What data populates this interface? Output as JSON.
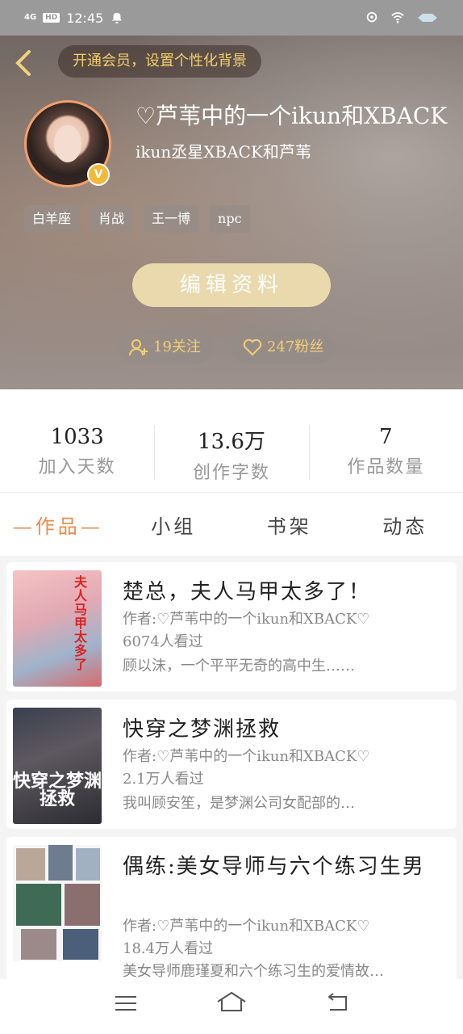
{
  "status_bar": {
    "network": "4G",
    "hd": "HD",
    "time": "12:45",
    "icons": [
      "location-icon",
      "wifi-icon",
      "battery-icon"
    ]
  },
  "header": {
    "back_glyph": "‹",
    "vip_banner": "开通会员，设置个性化背景",
    "nickname": "♡芦苇中的一个ikun和XBACK",
    "signature": "ikun丞星XBACK和芦苇",
    "badge": "V",
    "tags": [
      "白羊座",
      "肖战",
      "王一博",
      "npc"
    ],
    "edit_button": "编辑资料",
    "follow": "19关注",
    "fans": "247粉丝"
  },
  "stats": [
    {
      "value": "1033",
      "label": "加入天数"
    },
    {
      "value": "13.6万",
      "label": "创作字数"
    },
    {
      "value": "7",
      "label": "作品数量"
    }
  ],
  "tabs": [
    "—作品—",
    "小组",
    "书架",
    "动态"
  ],
  "books": [
    {
      "title": "楚总，夫人马甲太多了！",
      "author": "作者:♡芦苇中的一个ikun和XBACK♡",
      "views": "6074人看过",
      "desc": "顾以沫，一个平平无奇的高中生……"
    },
    {
      "title": "快穿之梦渊拯救",
      "author": "作者:♡芦苇中的一个ikun和XBACK♡",
      "views": "2.1万人看过",
      "desc": "我叫顾安笙，是梦渊公司女配部的…"
    },
    {
      "title": "偶练:美女导师与六个练习生男",
      "author": "作者:♡芦苇中的一个ikun和XBACK♡",
      "views": "18.4万人看过",
      "desc": "美女导师鹿瑾夏和六个练习生的爱情故…"
    }
  ],
  "covers": {
    "book1_text": "夫人马甲太多了",
    "book2_text": "快穿之梦渊拯救"
  },
  "colors": {
    "accent": "#f08a4b",
    "gold": "#f1cf74",
    "edit_button_bg": "#e9d9ad"
  }
}
